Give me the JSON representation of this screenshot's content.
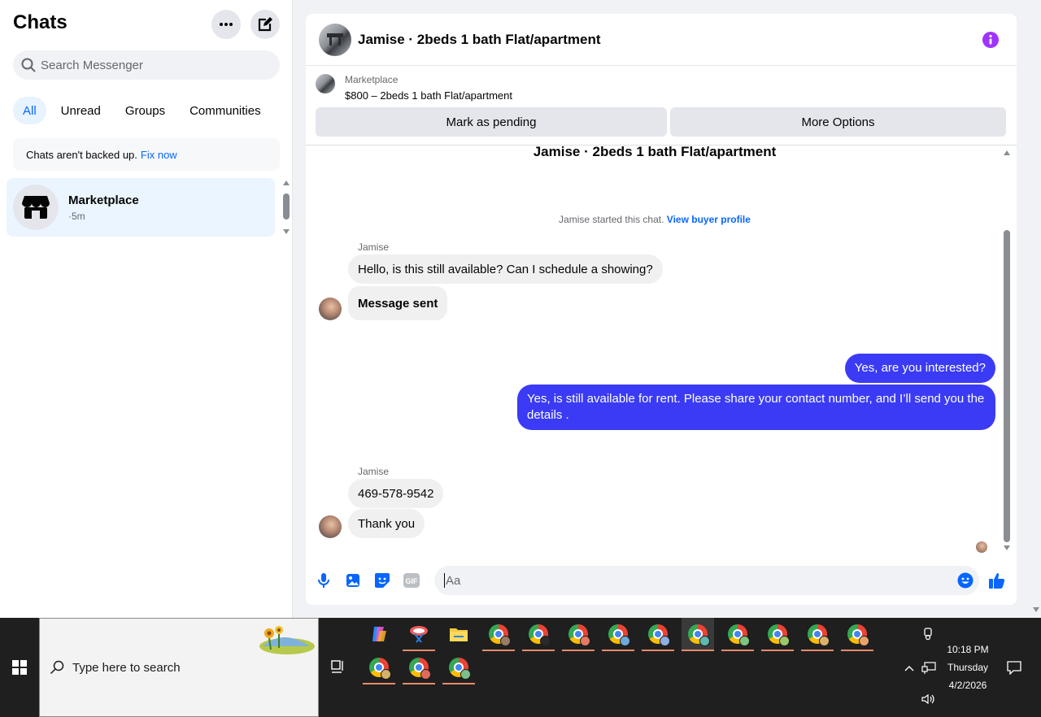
{
  "sidebar": {
    "title": "Chats",
    "search_placeholder": "Search Messenger",
    "tabs": [
      "All",
      "Unread",
      "Groups",
      "Communities"
    ],
    "backup_notice": "Chats aren't backed up.",
    "backup_link": "Fix now",
    "chat_items": [
      {
        "name": "Marketplace",
        "time": "·5m"
      }
    ]
  },
  "conversation": {
    "title": "Jamise · 2beds 1 bath Flat/apartment",
    "listing": {
      "source": "Marketplace",
      "price_line": "$800 – 2beds 1 bath Flat/apartment"
    },
    "buttons": {
      "pending": "Mark as pending",
      "more": "More Options"
    },
    "thread_title": "Jamise · 2beds 1 bath Flat/apartment",
    "started_text": "Jamise started this chat.",
    "buyer_profile_link": "View buyer profile",
    "messages": [
      {
        "sender": "Jamise",
        "text": "Hello, is this still available? Can I schedule a showing?"
      },
      {
        "text": "Message sent"
      },
      {
        "text": "Yes, are you interested?"
      },
      {
        "text": "Yes, is still available for rent. Please share your contact number, and I’ll send you the details ."
      },
      {
        "sender": "Jamise",
        "text": "469-578-9542"
      },
      {
        "text": "Thank you"
      }
    ],
    "composer_placeholder": "Aa",
    "gif_label": "GIF"
  },
  "taskbar": {
    "search_placeholder": "Type here to search",
    "time": "10:18 PM",
    "day": "Thursday",
    "date": "4/2/2026"
  },
  "colors": {
    "accent": "#0866ff",
    "outgoing_bubble": "#3b3bf5",
    "incoming_bubble": "#f0f0f0",
    "info": "#a033ff"
  }
}
